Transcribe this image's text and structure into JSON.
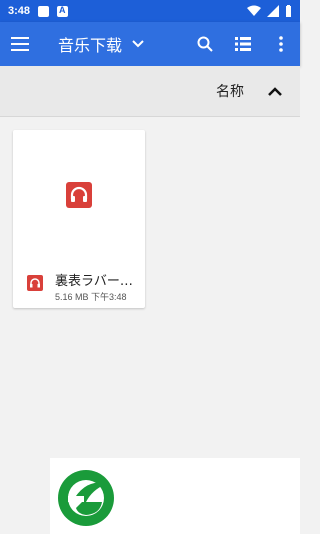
{
  "status_bar": {
    "time": "3:48"
  },
  "toolbar": {
    "title": "音乐下载",
    "icons": [
      "menu-icon",
      "dropdown-arrow-icon",
      "search-icon",
      "list-view-icon",
      "more-vert-icon"
    ]
  },
  "sort": {
    "label": "名称",
    "direction_icon": "chevron-up-icon"
  },
  "files": [
    {
      "name": "裏表ラバー…",
      "size": "5.16 MB",
      "time": "下午3:48",
      "icon": "headphones-icon"
    }
  ],
  "colors": {
    "status_bar": "#1d5fd8",
    "toolbar": "#2f6fe0",
    "file_icon": "#d9403a",
    "logo": "#1a9b3a"
  }
}
